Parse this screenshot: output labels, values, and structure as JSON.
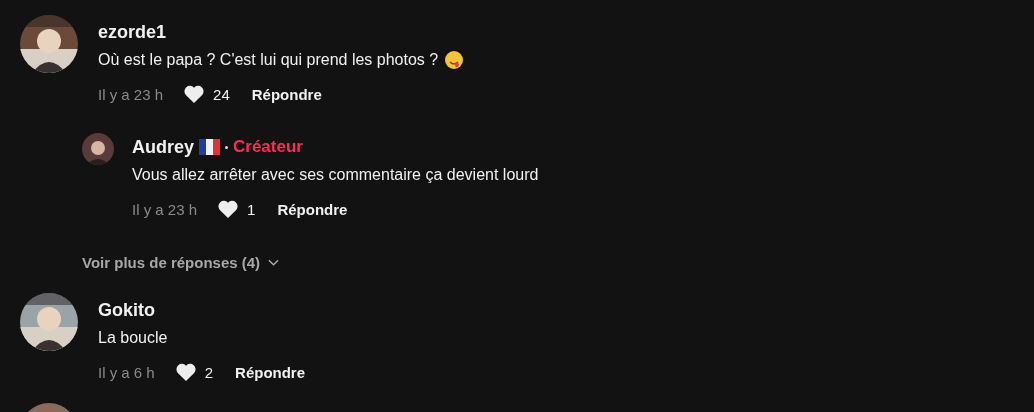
{
  "comments": [
    {
      "user": "ezorde1",
      "text": "Où est le papa ? C'est lui qui prend les photos ?",
      "emoji": true,
      "avatar": {
        "kind": "picture"
      },
      "time": "Il y a 23 h",
      "likes": "24",
      "reply_label": "Répondre",
      "replies": [
        {
          "user": "Audrey",
          "flag": true,
          "badge": "Créateur",
          "text": "Vous allez arrêter avec ses commentaire ça devient lourd",
          "avatar": {
            "kind": "picture"
          },
          "time": "Il y a 23 h",
          "likes": "1",
          "reply_label": "Répondre"
        }
      ],
      "more_replies": "Voir plus de réponses (4)"
    },
    {
      "user": "Gokito",
      "text": "La boucle",
      "avatar": {
        "kind": "picture"
      },
      "time": "Il y a 6 h",
      "likes": "2",
      "reply_label": "Répondre"
    }
  ],
  "next_comment": {
    "avatar": {
      "kind": "picture"
    }
  }
}
